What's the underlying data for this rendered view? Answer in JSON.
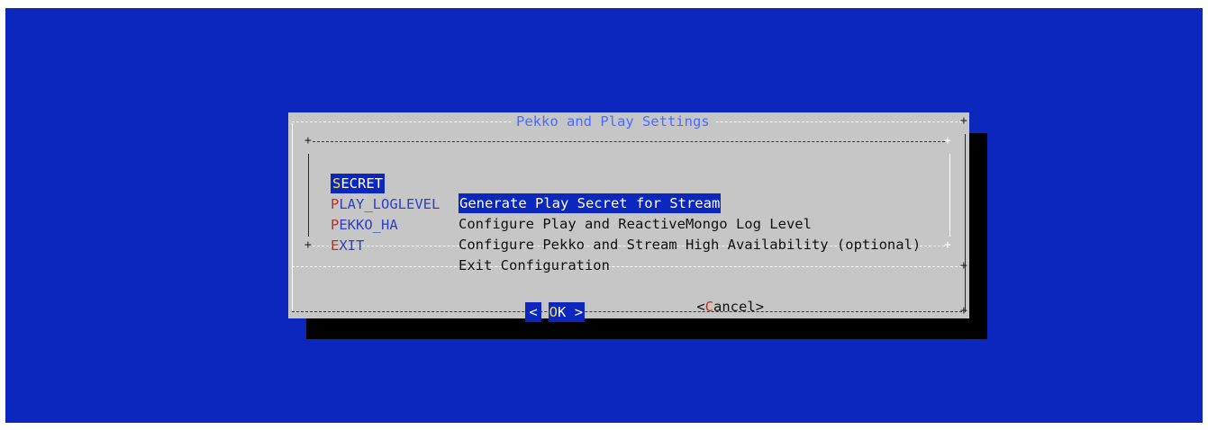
{
  "dialog": {
    "title": "Pekko and Play Settings"
  },
  "menu": {
    "items": [
      {
        "hot": "S",
        "rest": "ECRET",
        "description": "Generate Play Secret for Stream",
        "selected": true
      },
      {
        "hot": "P",
        "rest": "LAY_LOGLEVEL",
        "description": "Configure Play and ReactiveMongo Log Level",
        "selected": false
      },
      {
        "hot": "P",
        "rest": "EKKO_HA",
        "description": "Configure Pekko and Stream High Availability (optional)",
        "selected": false
      },
      {
        "hot": "E",
        "rest": "XIT",
        "description": "Exit Configuration",
        "selected": false
      }
    ]
  },
  "buttons": {
    "ok": {
      "open": "<",
      "hot": "O",
      "rest": "K",
      "close": ">"
    },
    "cancel": {
      "open": "<",
      "hot": "C",
      "rest": "ancel",
      "close": ">"
    }
  },
  "colors": {
    "background": "#0b27be",
    "dialog": "#c6c6c6",
    "shadow": "#000000",
    "title": "#4a6bff",
    "hotkey": "#b8321e",
    "selected_hotkey": "#f0e23a"
  }
}
